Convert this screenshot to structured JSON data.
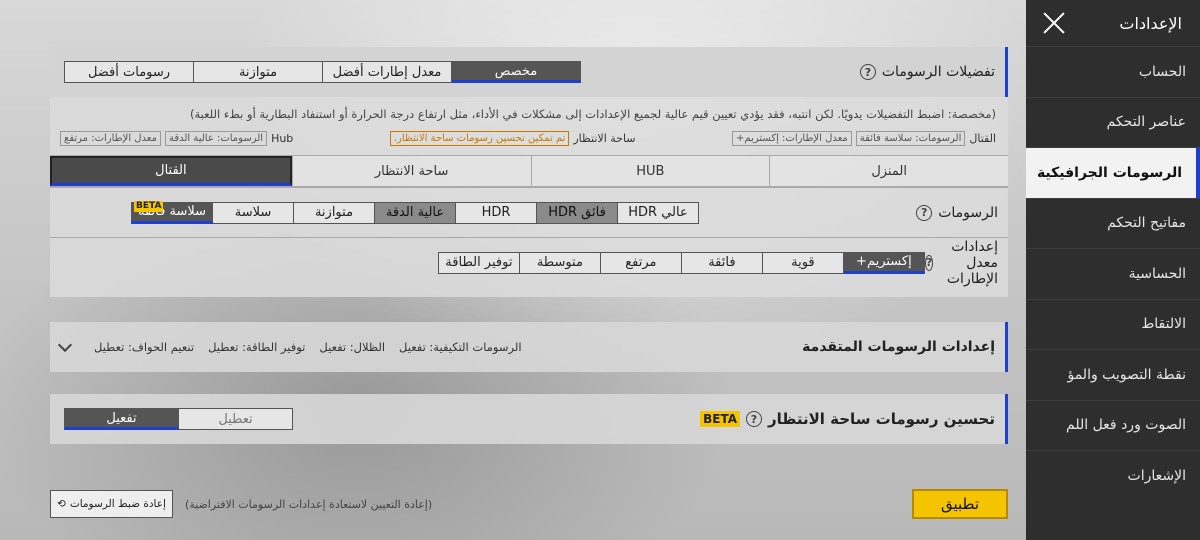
{
  "sidebar": {
    "title": "الإعدادات",
    "items": [
      {
        "label": "الحساب"
      },
      {
        "label": "عناصر التحكم"
      },
      {
        "label": "الرسومات الجرافيكية"
      },
      {
        "label": "مفاتيح التحكم"
      },
      {
        "label": "الحساسية"
      },
      {
        "label": "الالتقاط"
      },
      {
        "label": "نقطة التصويب والمؤ"
      },
      {
        "label": "الصوت ورد فعل اللم"
      },
      {
        "label": "الإشعارات"
      }
    ]
  },
  "preferences": {
    "title": "تفضيلات الرسومات",
    "options": [
      "مخصص",
      "معدل إطارات أفضل",
      "متوازنة",
      "رسومات أفضل"
    ],
    "description": "(مخصصة: اضبط التفضيلات يدويًا. لكن انتبه، فقد يؤدي تعيين قيم عالية لجميع الإعدادات إلى مشكلات في الأداء، مثل ارتفاع درجة الحرارة أو استنفاد البطارية أو بطء اللعبة)",
    "info": {
      "combat_label": "القتال",
      "combat_tags": [
        "الرسومات: سلاسة فائقة",
        "معدل الإطارات: إكستريم+"
      ],
      "lobby_label": "ساحة الانتظار",
      "lobby_tag": "تم تمكين تحسين رسومات ساحة الانتظار.",
      "hub_label": "Hub",
      "hub_tags": [
        "الرسومات: عالية الدقة",
        "معدل الإطارات: مرتفع"
      ]
    }
  },
  "mode_tabs": [
    "المنزل",
    "HUB",
    "ساحة الانتظار",
    "القتال"
  ],
  "graphics": {
    "title": "الرسومات",
    "options": [
      "عالي HDR",
      "فائق HDR",
      "HDR",
      "عالية الدقة",
      "متوازنة",
      "سلاسة",
      "سلاسة فائقة"
    ],
    "beta": "BETA"
  },
  "framerate": {
    "title": "إعدادات معدل الإطارات",
    "options": [
      "إكستريم+",
      "قوية",
      "فائقة",
      "مرتفع",
      "متوسطة",
      "توفير الطاقة"
    ]
  },
  "advanced": {
    "title": "إعدادات الرسومات المتقدمة",
    "values": [
      "الرسومات التكيفية: تفعيل",
      "الظلال: تفعيل",
      "توفير الطاقة: تعطيل",
      "تنعيم الحواف: تعطيل"
    ]
  },
  "lobby_opt": {
    "title": "تحسين رسومات ساحة الانتظار",
    "beta": "BETA",
    "off": "تعطيل",
    "on": "تفعيل"
  },
  "bottom": {
    "apply": "تطبيق",
    "reset_note": "(إعادة التعيين لاستعادة إعدادات الرسومات الافتراضية)",
    "reset_btn": "إعادة ضبط الرسومات"
  }
}
